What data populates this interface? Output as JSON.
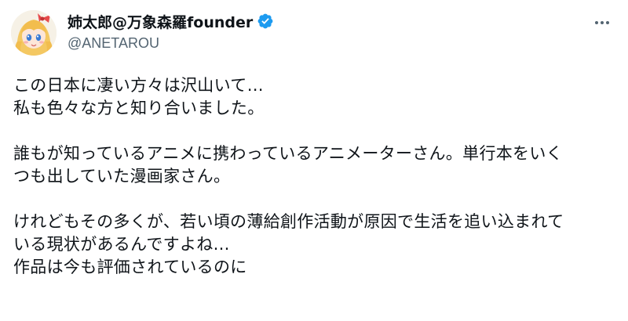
{
  "post": {
    "author": {
      "display_name": "姉太郎@万象森羅founder",
      "handle": "@ANETAROU",
      "verified": true
    },
    "paragraphs": [
      [
        "この日本に凄い方々は沢山いて…",
        "私も色々な方と知り合いました。"
      ],
      [
        "誰もが知っているアニメに携わっているアニメーターさん。単行本をいく",
        "つも出していた漫画家さん。"
      ],
      [
        "けれどもその多くが、若い頃の薄給創作活動が原因で生活を追い込まれて",
        "いる現状があるんですよね…",
        "作品は今も評価されているのに"
      ]
    ],
    "icons": {
      "verified": "verified-badge-icon",
      "more": "more-options-icon"
    },
    "colors": {
      "text": "#0f1419",
      "secondary": "#536471",
      "verified": "#1d9bf0"
    }
  }
}
